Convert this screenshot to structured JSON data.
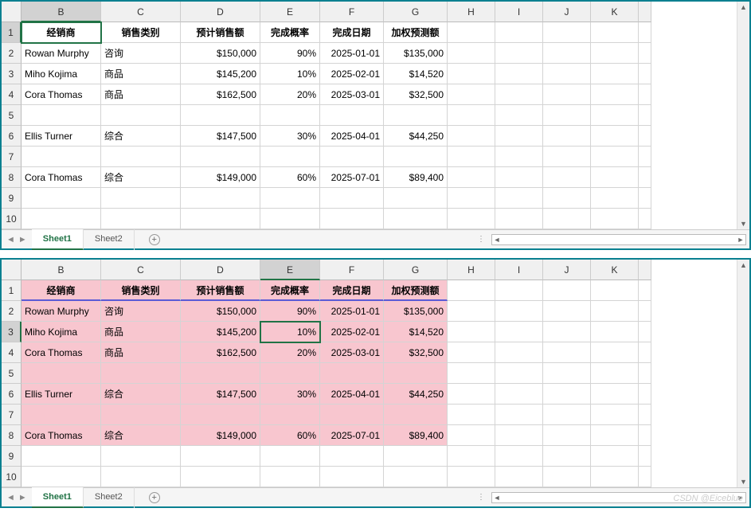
{
  "columns": [
    "B",
    "C",
    "D",
    "E",
    "F",
    "G",
    "H",
    "I",
    "J",
    "K"
  ],
  "headers": {
    "B": "经销商",
    "C": "销售类别",
    "D": "预计销售额",
    "E": "完成概率",
    "F": "完成日期",
    "G": "加权预测额"
  },
  "rows": [
    {
      "r": 2,
      "B": "Rowan Murphy",
      "C": "咨询",
      "D": "$150,000",
      "E": "90%",
      "F": "2025-01-01",
      "G": "$135,000"
    },
    {
      "r": 3,
      "B": "Miho Kojima",
      "C": "商品",
      "D": "$145,200",
      "E": "10%",
      "F": "2025-02-01",
      "G": "$14,520"
    },
    {
      "r": 4,
      "B": "Cora Thomas",
      "C": "商品",
      "D": "$162,500",
      "E": "20%",
      "F": "2025-03-01",
      "G": "$32,500"
    },
    {
      "r": 5,
      "B": "",
      "C": "",
      "D": "",
      "E": "",
      "F": "",
      "G": ""
    },
    {
      "r": 6,
      "B": "Ellis Turner",
      "C": "综合",
      "D": "$147,500",
      "E": "30%",
      "F": "2025-04-01",
      "G": "$44,250"
    },
    {
      "r": 7,
      "B": "",
      "C": "",
      "D": "",
      "E": "",
      "F": "",
      "G": ""
    },
    {
      "r": 8,
      "B": "Cora Thomas",
      "C": "综合",
      "D": "$149,000",
      "E": "60%",
      "F": "2025-07-01",
      "G": "$89,400"
    },
    {
      "r": 9,
      "B": "",
      "C": "",
      "D": "",
      "E": "",
      "F": "",
      "G": ""
    },
    {
      "r": 10,
      "B": "",
      "C": "",
      "D": "",
      "E": "",
      "F": "",
      "G": ""
    }
  ],
  "panel1": {
    "activeCell": "B1",
    "selCol": "B",
    "selRow": 1
  },
  "panel2": {
    "activeCell": "E3",
    "selCol": "E",
    "selRow": 3
  },
  "tabs": {
    "items": [
      "Sheet1",
      "Sheet2"
    ],
    "active": "Sheet1"
  },
  "watermark": "CSDN @Eiceblue"
}
